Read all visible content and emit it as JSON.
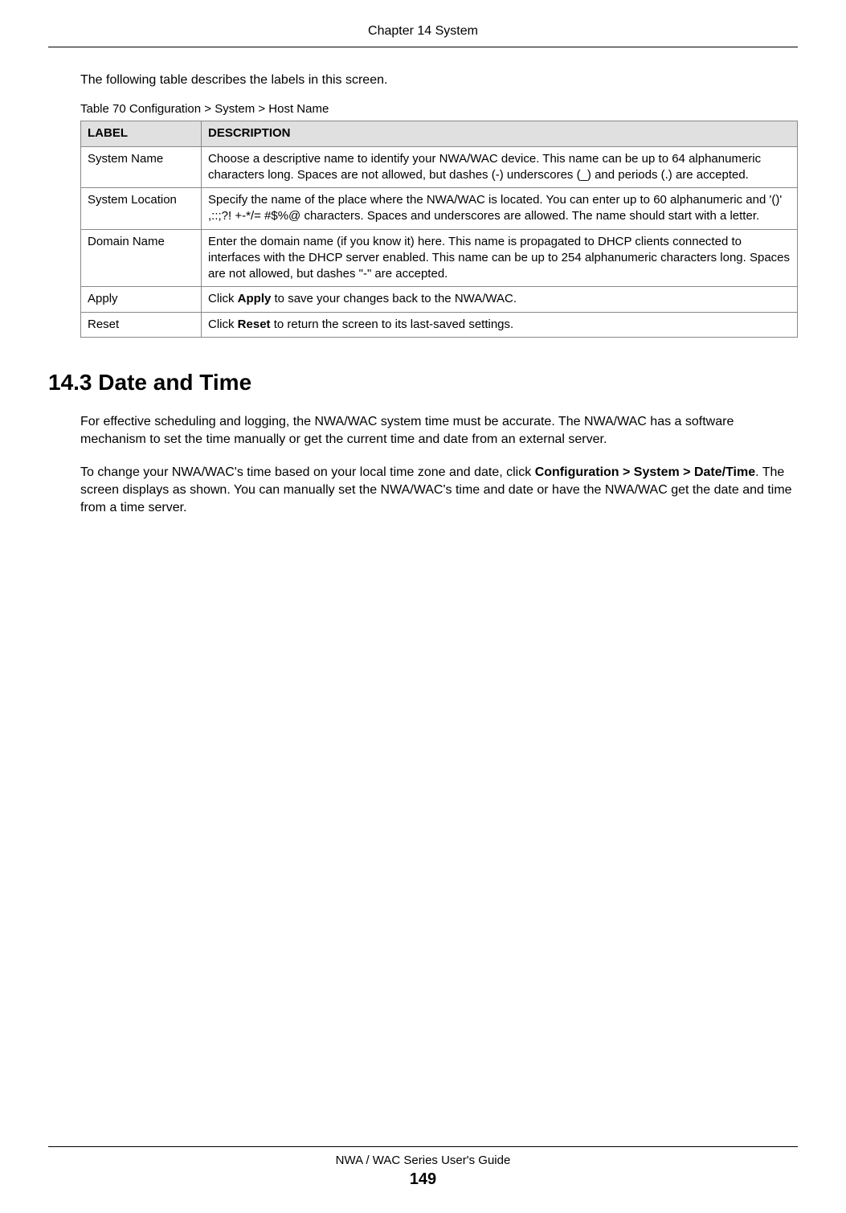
{
  "chapter_header": "Chapter 14 System",
  "intro": "The following table describes the labels in this screen.",
  "table_caption": "Table 70   Configuration > System > Host Name",
  "table": {
    "header_label": "LABEL",
    "header_description": "DESCRIPTION",
    "rows": [
      {
        "label": "System Name",
        "description": "Choose a descriptive name to identify your NWA/WAC device. This name can be up to 64 alphanumeric characters long. Spaces are not allowed, but dashes (-) underscores (_) and periods (.) are accepted."
      },
      {
        "label": "System Location",
        "description": "Specify the name of the place where the NWA/WAC is located. You can enter up to 60 alphanumeric and '()' ,::;?! +-*/= #$%@ characters. Spaces and underscores are allowed. The name should start with a letter."
      },
      {
        "label": "Domain Name",
        "description": "Enter the domain name (if you know it) here. This name is propagated to DHCP clients connected to interfaces with the DHCP server enabled. This name can be up to 254 alphanumeric characters long. Spaces are not allowed, but dashes \"-\" are accepted."
      },
      {
        "label": "Apply",
        "desc_pre": "Click ",
        "desc_bold": "Apply",
        "desc_post": " to save your changes back to the NWA/WAC."
      },
      {
        "label": "Reset",
        "desc_pre": "Click ",
        "desc_bold": "Reset",
        "desc_post": " to return the screen to its last-saved settings."
      }
    ]
  },
  "section_heading": "14.3  Date and Time",
  "para1": "For effective scheduling and logging, the NWA/WAC system time must be accurate. The NWA/WAC has a software mechanism to set the time manually or get the current time and date from an external server.",
  "para2_pre": "To change your NWA/WAC's time based on your local time zone and date, click ",
  "para2_bold": "Configuration > System > Date/Time",
  "para2_post": ". The screen displays as shown. You can manually set the NWA/WAC's time and date or have the NWA/WAC get the date and time from a time server.",
  "footer_text": "NWA / WAC Series User's Guide",
  "page_number": "149"
}
